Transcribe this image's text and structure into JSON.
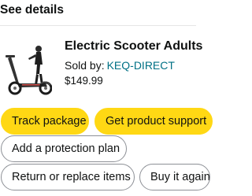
{
  "header": {
    "title": "See details"
  },
  "product": {
    "title": "Electric Scooter Adults",
    "sold_by_label": "Sold by:",
    "seller": "KEQ-DIRECT",
    "price": "$149.99"
  },
  "actions": {
    "track_package": "Track package",
    "get_support": "Get product support",
    "protection_plan": "Add a protection plan",
    "return_replace": "Return or replace items",
    "buy_again": "Buy it again"
  },
  "colors": {
    "primary_button": "#FFD814",
    "link": "#007185",
    "outline": "#8D9096"
  }
}
